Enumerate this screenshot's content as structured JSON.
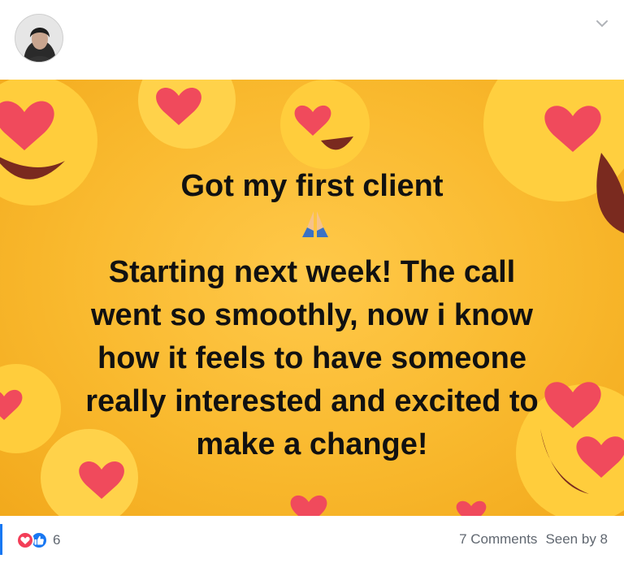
{
  "post": {
    "text_lines": [
      "Got my first client",
      "Starting next week! The call",
      "went so smoothly, now i know",
      "how it feels to have someone",
      "really interested and excited to",
      "make a change!"
    ],
    "banner_color": "#f9b92e",
    "text_color": "#111111"
  },
  "footer": {
    "reaction_count": "6",
    "comments": "7 Comments",
    "seen_by": "Seen by 8",
    "love_color": "#f33e58",
    "like_color": "#1877f2"
  }
}
